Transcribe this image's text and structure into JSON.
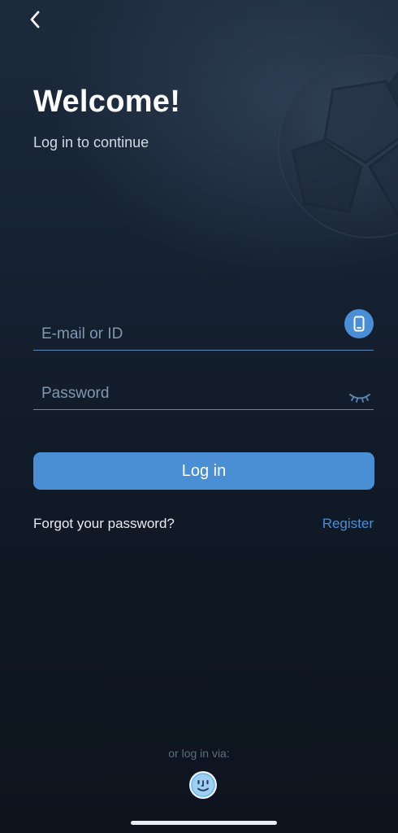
{
  "nav": {
    "back_icon": "chevron-left-icon"
  },
  "header": {
    "title": "Welcome!",
    "subtitle": "Log in to continue"
  },
  "form": {
    "email_placeholder": "E-mail or ID",
    "email_value": "",
    "phone_toggle_icon": "phone-icon",
    "password_placeholder": "Password",
    "password_value": "",
    "eye_icon": "eye-closed-icon",
    "login_label": "Log in"
  },
  "links": {
    "forgot_password": "Forgot your password?",
    "register": "Register"
  },
  "alt_login": {
    "label": "or log in via:",
    "icon": "face-id-icon"
  },
  "colors": {
    "accent": "#4a8ed3",
    "background": "#111a27",
    "underline": "#5b87b5"
  }
}
